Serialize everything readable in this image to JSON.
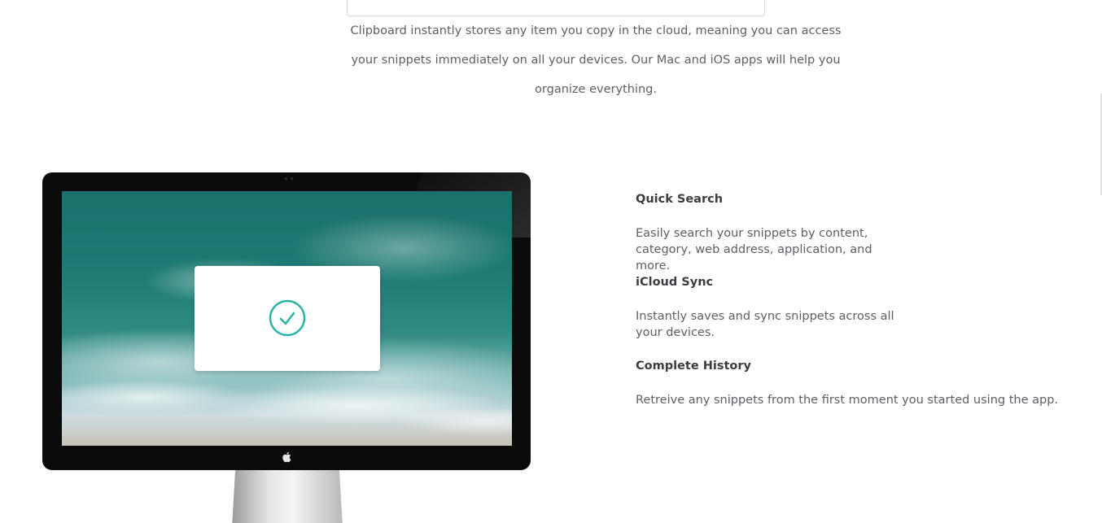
{
  "intro": {
    "line1": "Clipboard instantly stores any item you copy in the cloud, meaning you can access",
    "line2": "your snippets immediately on all your devices. Our Mac and iOS apps will help you",
    "line3": "organize everything."
  },
  "features": [
    {
      "title": "Quick Search",
      "desc_line1": "Easily search your snippets by content,",
      "desc_line2": "category, web address, application, and more."
    },
    {
      "title": "iCloud Sync",
      "desc_line1": "Instantly saves and sync snippets across all",
      "desc_line2": "your devices."
    },
    {
      "title": "Complete History",
      "desc_line1": "Retreive any snippets from the first moment you started using the app."
    }
  ],
  "icons": {
    "check": "check-circle-icon",
    "apple": "apple-logo-icon"
  },
  "colors": {
    "accent": "#2bb3a3",
    "text": "#5b5f66",
    "heading": "#3a3d42"
  }
}
